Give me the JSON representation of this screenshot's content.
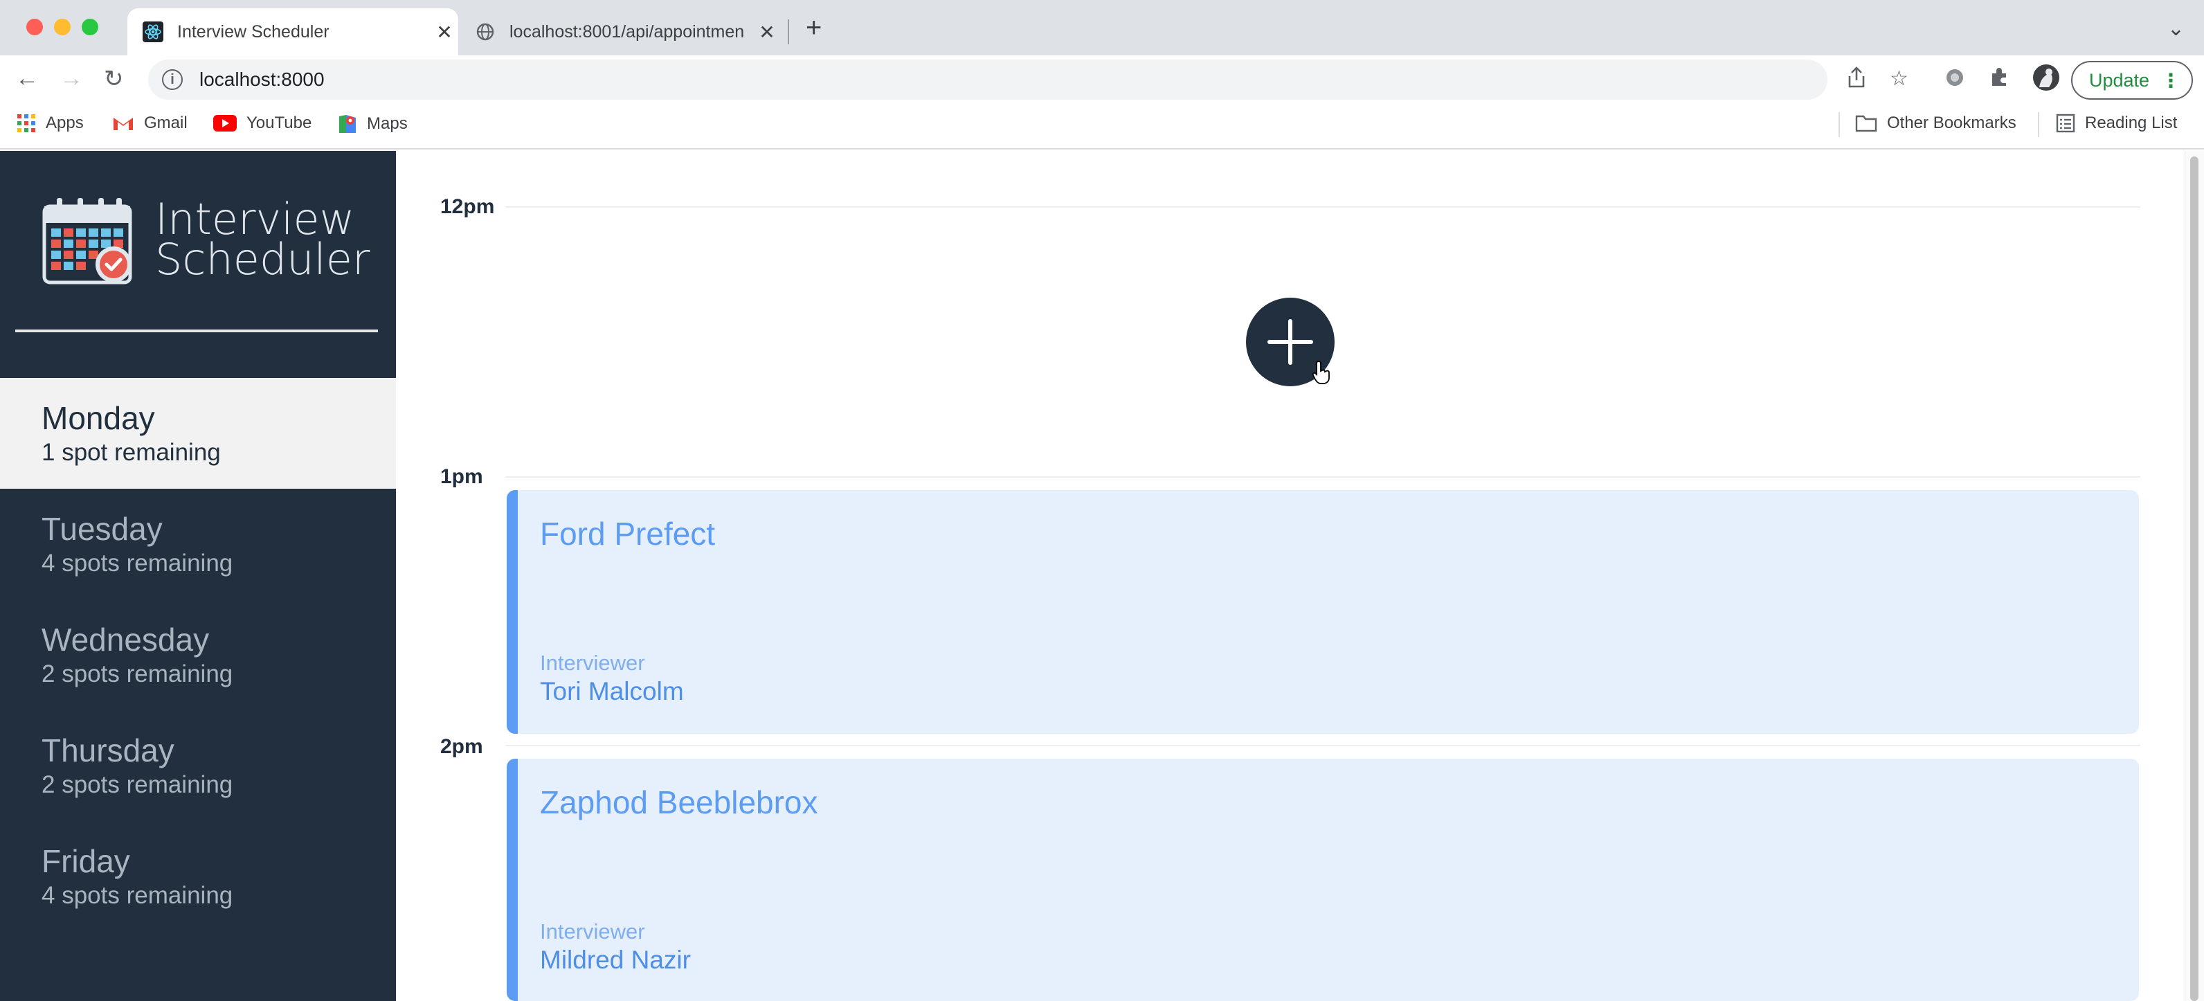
{
  "browser": {
    "tabs": [
      {
        "title": "Interview Scheduler",
        "active": true
      },
      {
        "title": "localhost:8001/api/appointmen",
        "active": false
      }
    ],
    "url": "localhost:8000",
    "update_label": "Update",
    "bookmarks": [
      "Apps",
      "Gmail",
      "YouTube",
      "Maps"
    ],
    "other_bookmarks": "Other Bookmarks",
    "reading_list": "Reading List"
  },
  "app": {
    "logo_line1": "Interview",
    "logo_line2": "Scheduler",
    "days": [
      {
        "name": "Monday",
        "spots": "1 spot remaining",
        "selected": true
      },
      {
        "name": "Tuesday",
        "spots": "4 spots remaining",
        "selected": false
      },
      {
        "name": "Wednesday",
        "spots": "2 spots remaining",
        "selected": false
      },
      {
        "name": "Thursday",
        "spots": "2 spots remaining",
        "selected": false
      },
      {
        "name": "Friday",
        "spots": "4 spots remaining",
        "selected": false
      }
    ],
    "times": [
      "12pm",
      "1pm",
      "2pm"
    ],
    "appointments": [
      {
        "student": "Ford Prefect",
        "interviewer_label": "Interviewer",
        "interviewer": "Tori Malcolm"
      },
      {
        "student": "Zaphod Beeblebrox",
        "interviewer_label": "Interviewer",
        "interviewer": "Mildred Nazir"
      }
    ]
  },
  "colors": {
    "sidebar": "#222f3e",
    "accent": "#5c9cf2",
    "appointment_bg": "#e6effc",
    "update_green": "#1e8e3e"
  },
  "icons": [
    "react-favicon",
    "globe-icon",
    "close-icon",
    "plus-icon",
    "back-icon",
    "forward-icon",
    "reload-icon",
    "info-icon",
    "share-icon",
    "star-icon",
    "extension-icon",
    "puzzle-icon",
    "profile-avatar",
    "apps-grid-icon",
    "gmail-icon",
    "youtube-icon",
    "maps-icon",
    "folder-icon",
    "reading-list-icon",
    "calendar-logo-icon",
    "add-appointment-icon"
  ]
}
